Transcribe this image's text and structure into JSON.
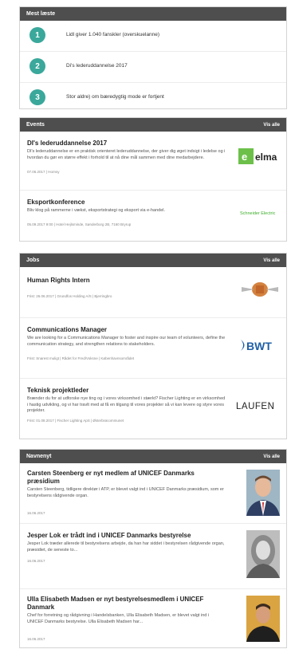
{
  "most_read": {
    "title": "Mest læste",
    "items": [
      {
        "rank": "1",
        "text": "Lidl giver 1.040 fanskler (overskuelanne)"
      },
      {
        "rank": "2",
        "text": "Di's lederuddannelse 2017"
      },
      {
        "rank": "3",
        "text": "Stor aldre) om bæredygtig mode er fortjent"
      }
    ]
  },
  "events": {
    "title": "Events",
    "see_all": "Vis alle",
    "items": [
      {
        "title": "DI's lederuddannelse 2017",
        "desc": "DI's lederuddannelse er en praktisk orienteret lederuddannelse, der giver dig øget indsigt i ledelse og i hvordan du gør en større effekt i forhold til at nå dine mål sammen med dine medarbejdere.",
        "meta": "07.06.2017 | Hornsy",
        "logo": "elma"
      },
      {
        "title": "Eksportkonference",
        "desc": "Bliv klog på rammerne i vækst, eksportstrategi og eksport via e-handel.",
        "meta": "05.09.2017 9:00 | Hotel Hejlsminde, Sønderborg 2B, 7160 Bryrup",
        "logo": "Schneider Electric"
      }
    ]
  },
  "jobs": {
    "title": "Jobs",
    "see_all": "Vis alle",
    "items": [
      {
        "title": "Human Rights Intern",
        "desc": "",
        "meta": "Frist: 26.06.2017 | Grundfos Holding A/S | Bjerringbro",
        "logo": ""
      },
      {
        "title": "Communications Manager",
        "desc": "We are looking for a Communications Manager to foster and inspire our team of volunteers, define the communication strategy, and strengthen relations to stakeholders.",
        "meta": "Frist: Snarest muligt | Rådet for Fred/Voksne | Københavnsområdet",
        "logo": "BWT"
      },
      {
        "title": "Teknisk projektleder",
        "desc": "Brænder du for at udforske nye ting og i vores virksomhed i stærkt? Fischer Lighting er en virksomhed i hastig udvikling, og vi har travlt med at få en tilgang til vores projekter så vi kan levere og styre vores projekter.",
        "meta": "Frist: 01.08.2017 | Fischer Lighting ApS | Østerbrøcommunet",
        "logo": "LAUFEN"
      }
    ]
  },
  "appointments": {
    "title": "Navnenyt",
    "see_all": "Vis alle",
    "items": [
      {
        "title": "Carsten Steenberg er nyt medlem af UNICEF Danmarks præsidium",
        "desc": "Carsten Steenberg, tidligere direktør i ATP, er blevet valgt ind i UNICEF Danmarks præsidium, som er bestyrelsens rådgivende organ.",
        "meta": "16.06.2017"
      },
      {
        "title": "Jesper Lok er trådt ind i UNICEF Danmarks bestyrelse",
        "desc": "Jesper Lok træder allerede til bestyrelsens arbejde, da han har siddet i bestyrelsen rådgivende organ, præsidiet, de seneste to...",
        "meta": "16.06.2017"
      },
      {
        "title": "Ulla Elisabeth Madsen er nyt bestyrelsesmedlem i UNICEF Danmark",
        "desc": "Chef for forretning og rådgivning i Handelsbanken, Ulla Elisabeth Madsen, er blevet valgt ind i UNICEF Danmarks bestyrelse. Ulla Elisabeth Madsen har...",
        "meta": "16.06.2017"
      }
    ]
  },
  "colors": {
    "header": "#4e4e4e",
    "accent": "#3aa89b",
    "elma_green": "#6cc04a",
    "bwt_blue": "#1f5fa6"
  }
}
